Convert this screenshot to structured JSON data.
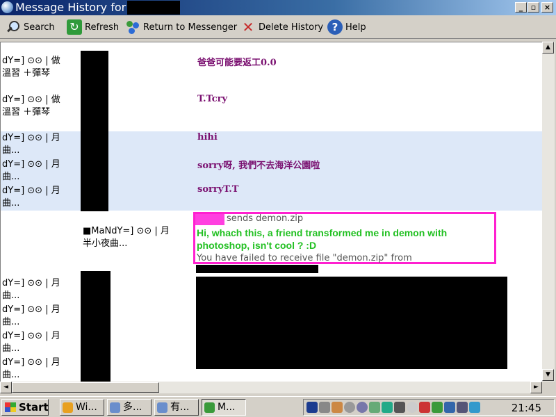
{
  "window": {
    "title": "Message History for",
    "controls": [
      "_",
      "▫",
      "×"
    ]
  },
  "toolbar": {
    "search": "Search",
    "refresh": "Refresh",
    "return": "Return to Messenger",
    "delete": "Delete History",
    "help": "Help"
  },
  "messages": [
    {
      "sender": "dY=] ⊙⊙ | 做\n溫習 ＋彈琴",
      "text": "爸爸可能要返工0.0"
    },
    {
      "sender": "dY=] ⊙⊙ | 做\n溫習 ＋彈琴",
      "text": "T.Tcry"
    },
    {
      "sender": "dY=] ⊙⊙ | 月\n曲...",
      "text": "hihi"
    },
    {
      "sender": "dY=] ⊙⊙ | 月\n曲...",
      "text": "sorry呀, 我們不去海洋公園啦"
    },
    {
      "sender": "dY=] ⊙⊙ | 月\n曲...",
      "text": "sorryT.T"
    }
  ],
  "file_transfer": {
    "sender": "■MaNdY=] ⊙⊙ | 月\n半小夜曲...",
    "sends": "sends demon.zip",
    "message": "Hi, whach this, a friend transformed me in demon with photoshop, isn't cool ? :D",
    "failure": "You have failed to receive file \"demon.zip\" from"
  },
  "later_senders": [
    "dY=] ⊙⊙ | 月\n曲...",
    "dY=] ⊙⊙ | 月\n曲...",
    "dY=] ⊙⊙ | 月\n曲...",
    "dY=] ⊙⊙ | 月\n曲..."
  ],
  "scroll": {
    "up": "▲",
    "down": "▼",
    "left": "◄",
    "right": "►"
  },
  "taskbar": {
    "start": "Start",
    "tasks": [
      "Wi...",
      "多...",
      "有...",
      "M..."
    ],
    "clock": "21:45"
  },
  "colors": {
    "message_text": "#7a1070",
    "alt_row": "#dde8f8",
    "highlight_border": "#ff20d0",
    "green_text": "#22c022"
  }
}
